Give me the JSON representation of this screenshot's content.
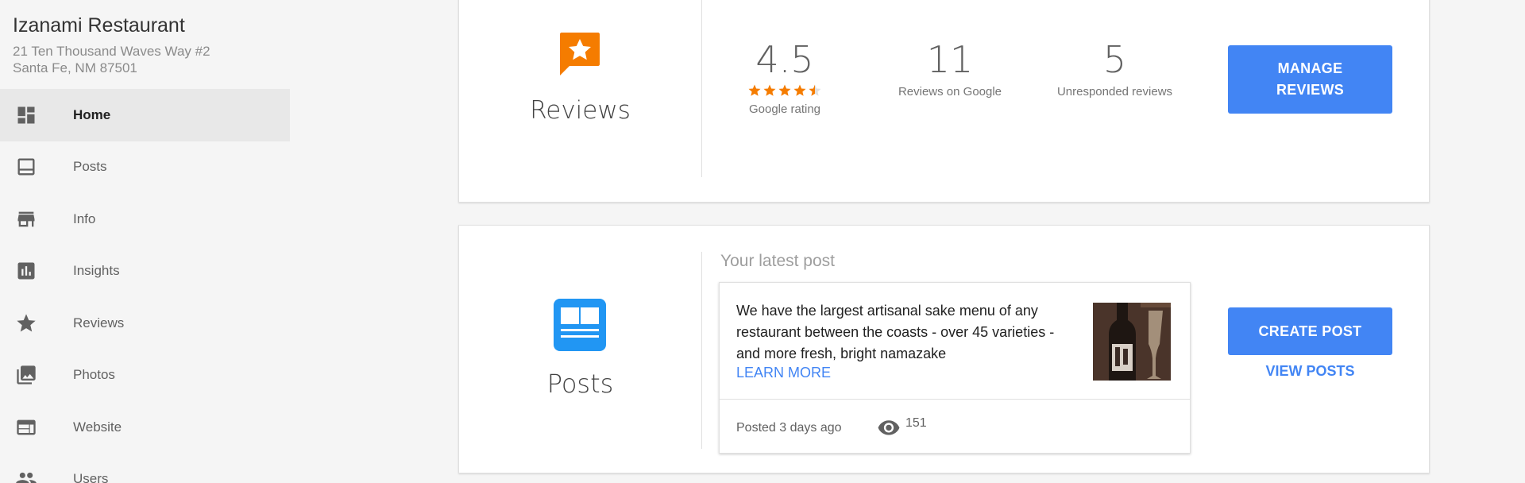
{
  "business": {
    "name": "Izanami Restaurant",
    "address_line1": "21 Ten Thousand Waves Way #2",
    "address_line2": "Santa Fe, NM 87501"
  },
  "sidebar": {
    "items": [
      {
        "label": "Home",
        "icon": "dashboard-icon",
        "active": true
      },
      {
        "label": "Posts",
        "icon": "posts-icon",
        "active": false
      },
      {
        "label": "Info",
        "icon": "store-icon",
        "active": false
      },
      {
        "label": "Insights",
        "icon": "bar-chart-icon",
        "active": false
      },
      {
        "label": "Reviews",
        "icon": "star-icon",
        "active": false
      },
      {
        "label": "Photos",
        "icon": "photos-icon",
        "active": false
      },
      {
        "label": "Website",
        "icon": "web-icon",
        "active": false
      },
      {
        "label": "Users",
        "icon": "people-icon",
        "active": false
      }
    ]
  },
  "reviews_card": {
    "title": "Reviews",
    "icon_color": "#f57c00",
    "rating": {
      "value": "4.5",
      "label": "Google rating",
      "stars": 4.5
    },
    "count": {
      "value": "11",
      "label": "Reviews on Google"
    },
    "unresponded": {
      "value": "5",
      "label": "Unresponded reviews"
    },
    "manage_button": "MANAGE REVIEWS"
  },
  "posts_card": {
    "title": "Posts",
    "icon_color": "#2196f3",
    "latest_label": "Your latest post",
    "post": {
      "text": "We have the largest artisanal sake menu of any restaurant between the coasts - over 45 varieties - and more fresh, bright namazake",
      "link": "LEARN MORE",
      "posted": "Posted 3 days ago",
      "views": "151"
    },
    "create_button": "CREATE POST",
    "view_link": "VIEW POSTS"
  },
  "colors": {
    "accent": "#4285f4",
    "star": "#f57c00"
  }
}
